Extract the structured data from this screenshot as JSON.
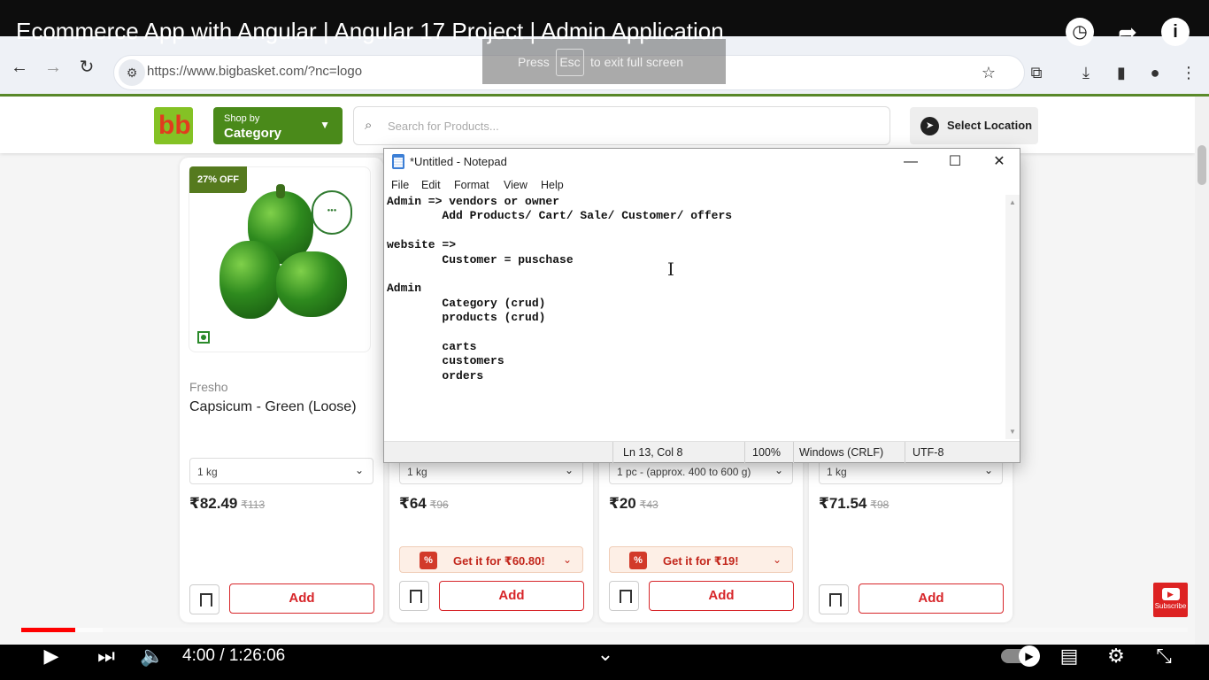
{
  "youtube": {
    "video_title": "Ecommerce App with Angular | Angular 17 Project | Admin Application",
    "time_current": "4:00",
    "time_separator": "/",
    "time_total": "1:26:06",
    "progress_played": 0.046,
    "progress_buffered": 0.07,
    "subscribe_label": "Subscribe"
  },
  "fullscreen_hint": {
    "prefix": "Press",
    "key": "Esc",
    "suffix": "to exit full screen"
  },
  "browser": {
    "url": "https://www.bigbasket.com/?nc=logo"
  },
  "bigbasket": {
    "logo_text": "bb",
    "category_small": "Shop by",
    "category_big": "Category",
    "search_placeholder": "Search for Products...",
    "location_label": "Select Location",
    "badge_off": "27% OFF",
    "products": [
      {
        "brand": "Fresho",
        "name": "Capsicum - Green (Loose)",
        "qty": "1 kg",
        "price": "₹82.49",
        "mrp": "₹113",
        "offer": "",
        "add": "Add"
      },
      {
        "brand": "",
        "name": "",
        "qty": "1 kg",
        "price": "₹64",
        "mrp": "₹96",
        "offer": "Get it for ₹60.80!",
        "add": "Add"
      },
      {
        "brand": "",
        "name": "",
        "qty": "1 pc - (approx. 400 to 600 g)",
        "price": "₹20",
        "mrp": "₹43",
        "offer": "Get it for ₹19!",
        "add": "Add"
      },
      {
        "brand": "",
        "name": "",
        "qty": "1 kg",
        "price": "₹71.54",
        "mrp": "₹98",
        "offer": "",
        "add": "Add"
      }
    ]
  },
  "notepad": {
    "title": "*Untitled - Notepad",
    "menu": [
      "File",
      "Edit",
      "Format",
      "View",
      "Help"
    ],
    "content": "Admin => vendors or owner\n        Add Products/ Cart/ Sale/ Customer/ offers\n\nwebsite =>\n        Customer = puschase\n\nAdmin\n        Category (crud)\n        products (crud)\n\n        carts\n        customers\n        orders",
    "status": {
      "position": "Ln 13, Col 8",
      "zoom": "100%",
      "line_ending": "Windows (CRLF)",
      "encoding": "UTF-8"
    }
  }
}
